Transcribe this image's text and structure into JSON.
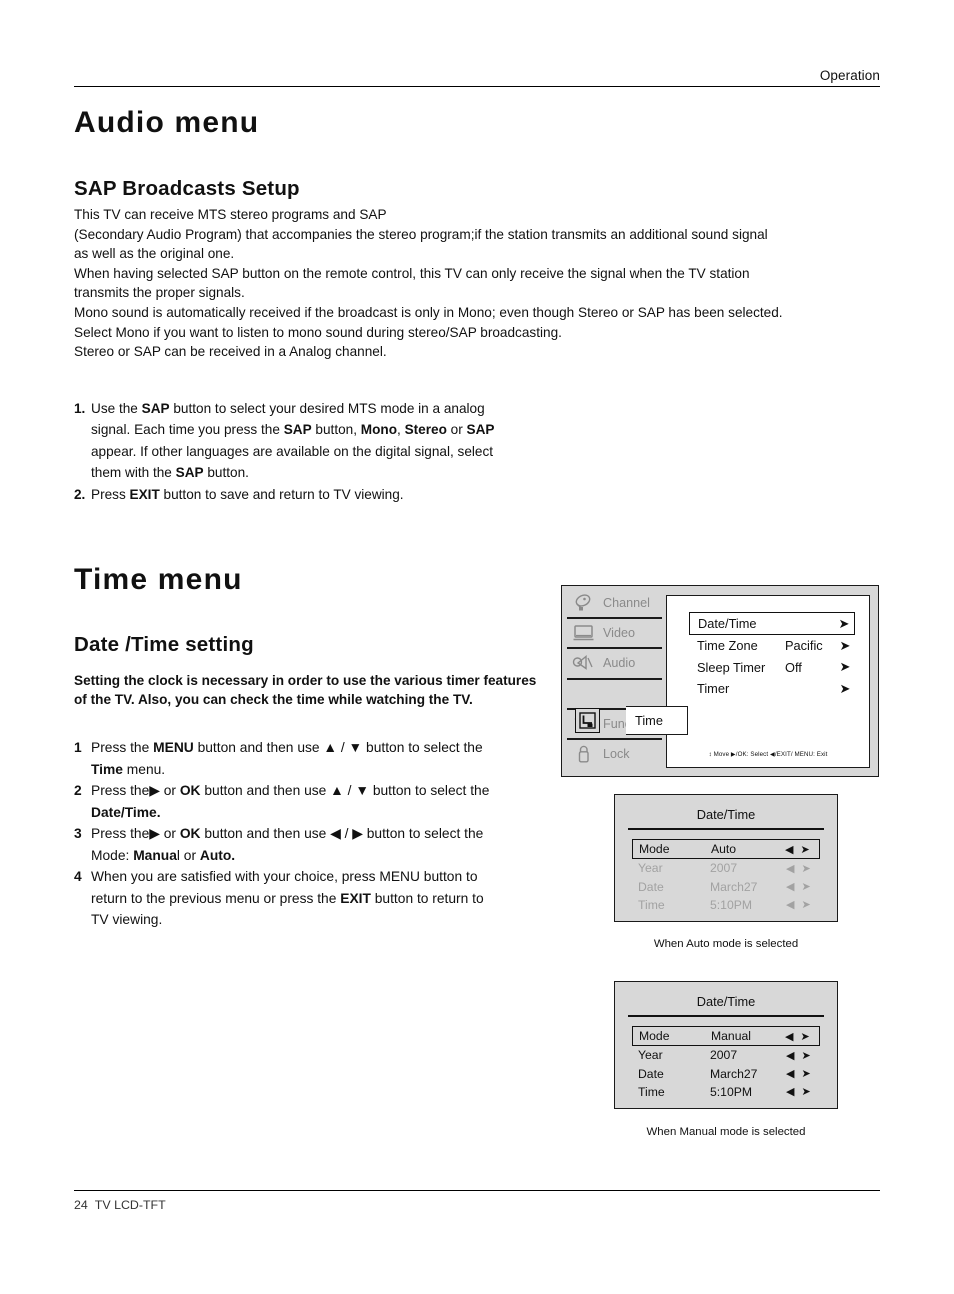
{
  "header": {
    "section_label": "Operation"
  },
  "audio_section": {
    "title": "Audio menu",
    "subtitle": "SAP Broadcasts Setup",
    "paragraph": "This TV can receive MTS stereo programs and SAP\n(Secondary Audio Program) that accompanies the stereo program;if the station transmits an additional sound signal\nas well as the original one.\nWhen having selected SAP button on the remote control, this TV can only receive the signal when the TV station\ntransmits the proper signals.\nMono sound is automatically received if the broadcast is only in Mono; even though Stereo or SAP has been selected.\nSelect Mono if you want to listen to mono sound during stereo/SAP broadcasting.\nStereo or SAP can be received in a Analog channel.",
    "steps": [
      {
        "num": "1.",
        "html": "Use the <b>SAP</b> button to select your desired MTS mode in a analog<br>signal. Each time you press the <b>SAP</b> button, <b>Mono</b>, <b>Stereo</b> or <b>SAP</b><br>appear.  If other languages are available on the digital signal, select<br>them with the <b>SAP</b> button."
      },
      {
        "num": "2.",
        "html": "Press <b>EXIT</b> button to save and return to TV viewing."
      }
    ]
  },
  "time_section": {
    "title": "Time menu",
    "subtitle": "Date /Time setting",
    "intro": "Setting the clock is necessary in order to use the various timer features   of the TV. Also, you can check the time while watching the TV.",
    "steps": [
      {
        "num": "1",
        "html": "Press the <b>MENU</b> button and then use ▲ / ▼ button to select the<br><b>Time</b> menu."
      },
      {
        "num": "2",
        "html": "Press the▶ or <b>OK</b> button and then use ▲ / ▼ button to select the<br><b>Date/Time.</b>"
      },
      {
        "num": "3",
        "html": "Press the▶ or <b>OK</b> button and then use ◀ / ▶ button to select the<br>Mode: <b>Manua</b>l or <b>Auto.</b>"
      },
      {
        "num": "4",
        "html": "When you are satisfied with your choice,  press MENU button to<br>return to the previous menu or press the <b>EXIT</b> button to return to<br>TV viewing."
      }
    ]
  },
  "osd_main_menu": {
    "sidebar": [
      {
        "label": "Channel",
        "icon": "satellite-dish-icon",
        "active": false
      },
      {
        "label": "Video",
        "icon": "monitor-icon",
        "active": false
      },
      {
        "label": "Audio",
        "icon": "speaker-icon",
        "active": false
      },
      {
        "label": "Time",
        "icon": "clock-timer-icon",
        "active": true
      },
      {
        "label": "Function",
        "icon": "function-box-icon",
        "active": false
      },
      {
        "label": "Lock",
        "icon": "padlock-icon",
        "active": false
      }
    ],
    "rows": [
      {
        "label": "Date/Time",
        "value": "",
        "arrow": "➤",
        "selected": true
      },
      {
        "label": "Time Zone",
        "value": "Pacific",
        "arrow": "➤",
        "selected": false
      },
      {
        "label": "Sleep Timer",
        "value": "Off",
        "arrow": "➤",
        "selected": false
      },
      {
        "label": "Timer",
        "value": "",
        "arrow": "➤",
        "selected": false
      }
    ],
    "hint": "↕ Move  ▶/OK: Select  ◀/EXIT/ MENU: Exit"
  },
  "osd_auto": {
    "title": "Date/Time",
    "caption": "When Auto mode is selected",
    "rows": [
      {
        "label": "Mode",
        "value": "Auto",
        "arrows": "◀ ➤",
        "selected": true,
        "dim": false
      },
      {
        "label": "Year",
        "value": "2007",
        "arrows": "◀ ➤",
        "selected": false,
        "dim": true
      },
      {
        "label": "Date",
        "value": "March27",
        "arrows": "◀ ➤",
        "selected": false,
        "dim": true
      },
      {
        "label": "Time",
        "value": "5:10PM",
        "arrows": "◀ ➤",
        "selected": false,
        "dim": true
      }
    ]
  },
  "osd_manual": {
    "title": "Date/Time",
    "caption": "When Manual mode is selected",
    "rows": [
      {
        "label": "Mode",
        "value": "Manual",
        "arrows": "◀ ➤",
        "selected": true,
        "dim": false
      },
      {
        "label": "Year",
        "value": "2007",
        "arrows": "◀ ➤",
        "selected": false,
        "dim": false
      },
      {
        "label": "Date",
        "value": "March27",
        "arrows": "◀ ➤",
        "selected": false,
        "dim": false
      },
      {
        "label": "Time",
        "value": "5:10PM",
        "arrows": "◀ ➤",
        "selected": false,
        "dim": false
      }
    ]
  },
  "footer": {
    "page_number": "24",
    "document_label": "TV LCD-TFT"
  },
  "colors": {
    "osd_background": "#d8d8d8",
    "osd_panel": "#ffffff",
    "osd_border": "#1a1a1a",
    "dim_text": "#a2a2a2",
    "body_text": "#111111"
  }
}
